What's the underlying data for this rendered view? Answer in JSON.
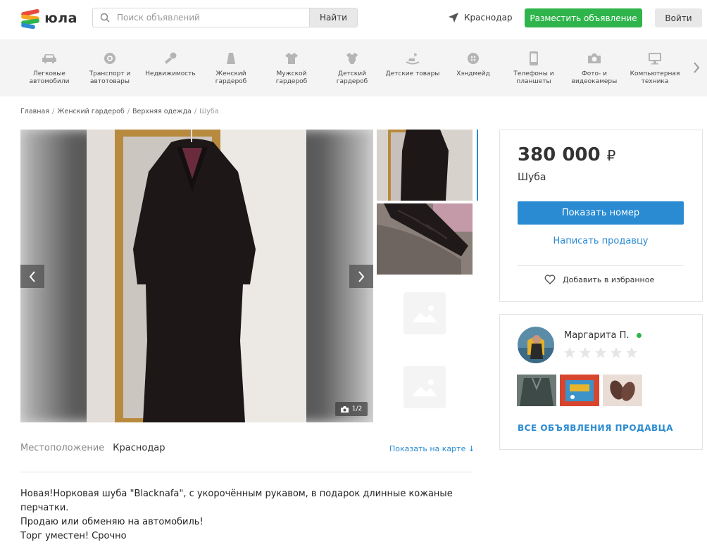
{
  "header": {
    "logo_text": "юла",
    "search_placeholder": "Поиск объявлений",
    "search_button": "Найти",
    "city": "Краснодар",
    "post_button": "Разместить объявление",
    "login_button": "Войти",
    "logo_colors": [
      "#e84b3c",
      "#f5a623",
      "#2eb44b",
      "#2a8bd2"
    ]
  },
  "categories": [
    {
      "label": "Легковые автомобили",
      "icon": "car-icon"
    },
    {
      "label": "Транспорт и автотовары",
      "icon": "wheel-icon"
    },
    {
      "label": "Недвижимость",
      "icon": "key-icon"
    },
    {
      "label": "Женский гардероб",
      "icon": "skirt-icon"
    },
    {
      "label": "Мужской гардероб",
      "icon": "shirt-icon"
    },
    {
      "label": "Детский гардероб",
      "icon": "bodysuit-icon"
    },
    {
      "label": "Детские товары",
      "icon": "rocking-horse-icon"
    },
    {
      "label": "Хэндмейд",
      "icon": "button-icon"
    },
    {
      "label": "Телефоны и планшеты",
      "icon": "phone-icon"
    },
    {
      "label": "Фото- и видеокамеры",
      "icon": "camera-icon"
    },
    {
      "label": "Компьютерная техника",
      "icon": "monitor-icon"
    }
  ],
  "breadcrumbs": [
    "Главная",
    "Женский гардероб",
    "Верхняя одежда",
    "Шуба"
  ],
  "gallery": {
    "counter": "1/2"
  },
  "location": {
    "label": "Местоположение",
    "value": "Краснодар",
    "map_link": "Показать на карте ↓"
  },
  "description": [
    "Новая!Норковая шуба \"Blacknafa\", с укорочённым рукавом, в подарок длинные кожаные перчатки.",
    "Продаю или обменяю на автомобиль!",
    "Торг уместен! Срочно"
  ],
  "offer": {
    "price": "380 000",
    "currency": "₽",
    "title": "Шуба",
    "show_phone": "Показать номер",
    "write_seller": "Написать продавцу",
    "favorite": "Добавить в избранное"
  },
  "seller": {
    "name": "Маргарита П.",
    "rating": 0,
    "rating_max": 5,
    "all_ads": "ВСЕ ОБЪЯВЛЕНИЯ ПРОДАВЦА"
  },
  "colors": {
    "accent_blue": "#2a8bd2",
    "accent_green": "#2eb44b"
  }
}
